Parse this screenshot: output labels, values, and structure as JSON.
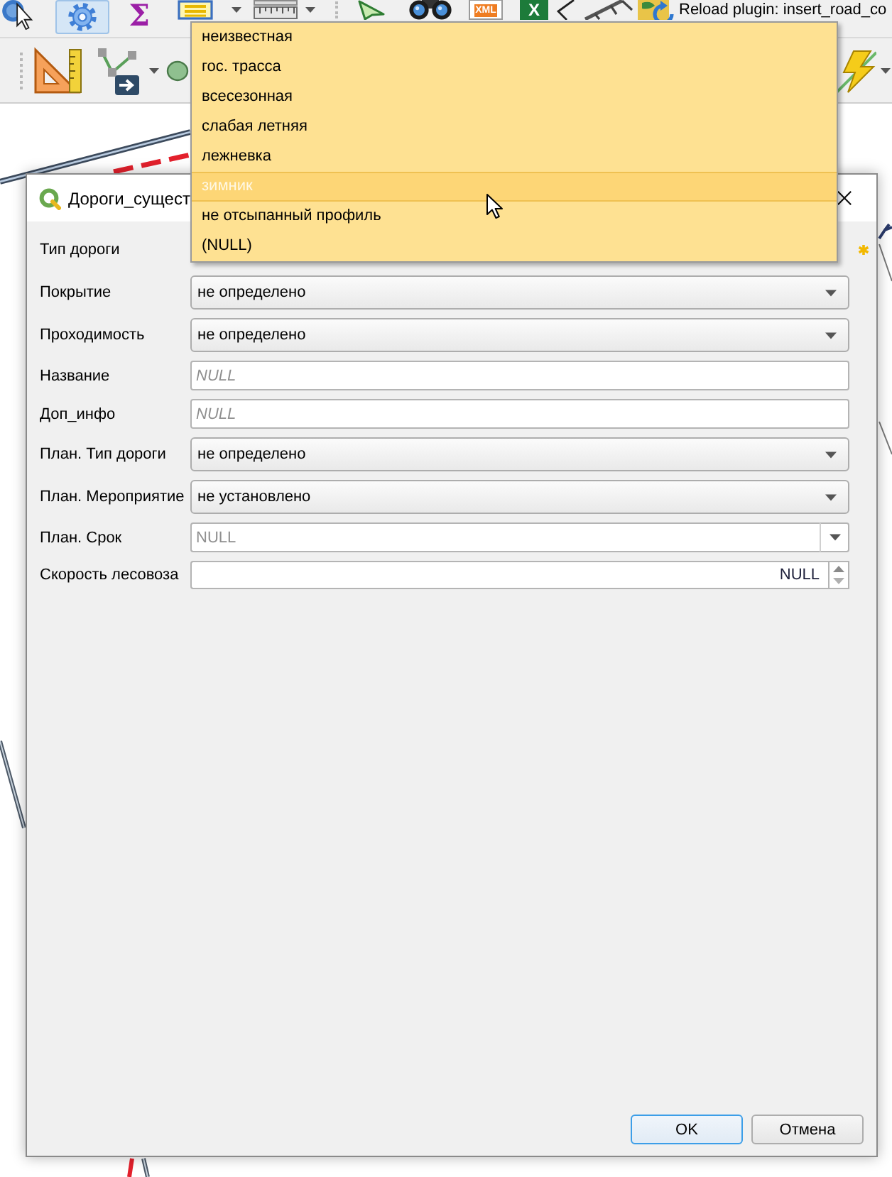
{
  "toolbar": {
    "tools": [
      {
        "checked": false
      },
      {
        "checked": true
      },
      {
        "checked": false,
        "label": "Σ"
      },
      {
        "checked": false
      },
      {
        "checked": false
      },
      {
        "checked": false
      },
      {
        "checked": false
      },
      {
        "checked": false,
        "label": "XML"
      },
      {
        "checked": false,
        "label": "X"
      },
      {
        "checked": false
      },
      {
        "checked": false
      },
      {
        "checked": false
      }
    ],
    "plugin_status": "Reload plugin: insert_road_co"
  },
  "dialog": {
    "title": "Дороги_сущест",
    "fields": [
      {
        "label": "Тип дороги",
        "kind": "combo",
        "expanded": true,
        "constraint": true,
        "options": [
          {
            "label": "неизвестная",
            "selected": false
          },
          {
            "label": "гос. трасса",
            "selected": false
          },
          {
            "label": "всесезонная",
            "selected": false
          },
          {
            "label": "слабая летняя",
            "selected": false
          },
          {
            "label": "лежневка",
            "selected": false
          },
          {
            "label": "зимник",
            "selected": true
          },
          {
            "label": "не отсыпанный профиль",
            "selected": false
          },
          {
            "label": "(NULL)",
            "selected": false
          }
        ]
      },
      {
        "label": "Покрытие",
        "kind": "combo",
        "expanded": false,
        "constraint": false,
        "value": "не определено"
      },
      {
        "label": "Проходимость",
        "kind": "combo",
        "expanded": false,
        "constraint": false,
        "value": "не определено"
      },
      {
        "label": "Название",
        "kind": "text",
        "constraint": false,
        "placeholder": "NULL"
      },
      {
        "label": "Доп_инфо",
        "kind": "text",
        "constraint": false,
        "placeholder": "NULL"
      },
      {
        "label": "План. Тип дороги",
        "kind": "combo",
        "expanded": false,
        "constraint": false,
        "value": "не определено"
      },
      {
        "label": "План. Мероприятие",
        "kind": "combo",
        "expanded": false,
        "constraint": false,
        "value": "не установлено"
      },
      {
        "label": "План. Срок",
        "kind": "date",
        "constraint": false,
        "placeholder": "NULL"
      },
      {
        "label": "Скорость лесовоза",
        "kind": "spin",
        "constraint": false,
        "value": "NULL"
      }
    ],
    "buttons": [
      {
        "label": "OK",
        "default": true
      },
      {
        "label": "Отмена",
        "default": false
      }
    ]
  }
}
